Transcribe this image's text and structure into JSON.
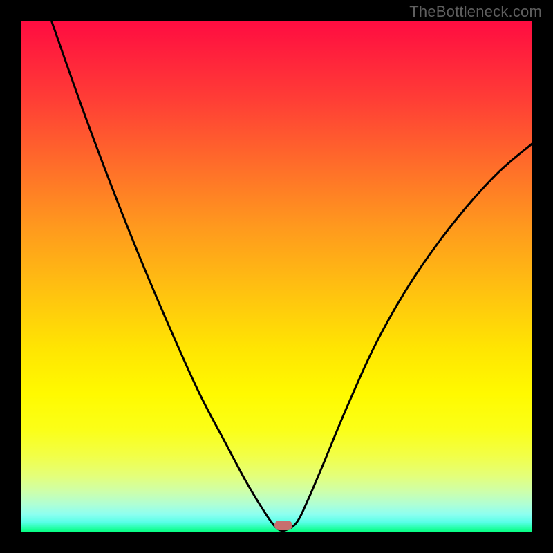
{
  "watermark": "TheBottleneck.com",
  "marker": {
    "x_frac": 0.513,
    "y_frac": 0.987
  },
  "chart_data": {
    "type": "line",
    "title": "",
    "xlabel": "",
    "ylabel": "",
    "xlim": [
      0,
      1
    ],
    "ylim": [
      0,
      1
    ],
    "series": [
      {
        "name": "bottleneck-curve",
        "x": [
          0.06,
          0.12,
          0.18,
          0.24,
          0.3,
          0.35,
          0.4,
          0.44,
          0.47,
          0.49,
          0.505,
          0.52,
          0.54,
          0.56,
          0.59,
          0.64,
          0.7,
          0.77,
          0.85,
          0.93,
          1.0
        ],
        "y": [
          1.0,
          0.83,
          0.67,
          0.52,
          0.38,
          0.27,
          0.175,
          0.1,
          0.05,
          0.02,
          0.005,
          0.005,
          0.02,
          0.06,
          0.13,
          0.25,
          0.38,
          0.5,
          0.61,
          0.7,
          0.76
        ]
      }
    ],
    "annotations": [
      {
        "name": "optimal-marker",
        "x": 0.513,
        "y": 0.013
      }
    ],
    "background_gradient": {
      "top": "#ff0c41",
      "mid": "#ffe502",
      "bottom": "#00ff7c"
    }
  }
}
